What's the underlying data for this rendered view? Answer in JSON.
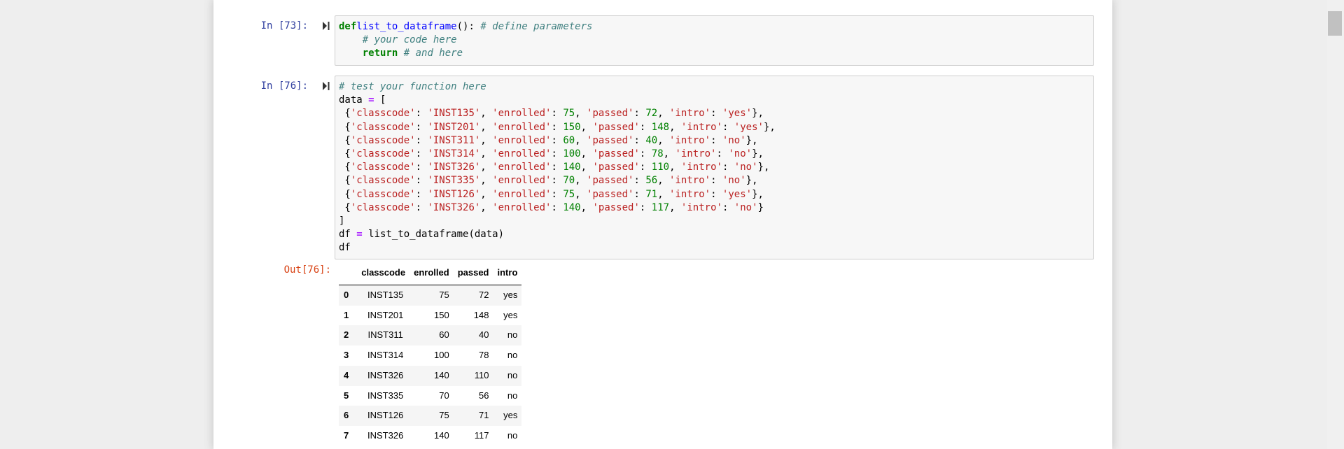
{
  "cells": [
    {
      "prompt": "In [73]:",
      "code_tokens": [
        [
          "kw",
          "def"
        ],
        [
          "",
          ""
        ],
        [
          "fn",
          "list_to_dataframe"
        ],
        [
          "",
          "(): "
        ],
        [
          "cm",
          "# define parameters"
        ],
        [
          "",
          "\n    "
        ],
        [
          "cm",
          "# your code here"
        ],
        [
          "",
          "\n    "
        ],
        [
          "kw",
          "return"
        ],
        [
          "",
          " "
        ],
        [
          "cm",
          "# and here"
        ]
      ]
    },
    {
      "prompt": "In [76]:",
      "code_tokens": [
        [
          "cm",
          "# test your function here"
        ],
        [
          "",
          "\ndata "
        ],
        [
          "op",
          "="
        ],
        [
          "",
          " [\n {"
        ],
        [
          "st",
          "'classcode'"
        ],
        [
          "",
          ": "
        ],
        [
          "st",
          "'INST135'"
        ],
        [
          "",
          ", "
        ],
        [
          "st",
          "'enrolled'"
        ],
        [
          "",
          ": "
        ],
        [
          "nm",
          "75"
        ],
        [
          "",
          ", "
        ],
        [
          "st",
          "'passed'"
        ],
        [
          "",
          ": "
        ],
        [
          "nm",
          "72"
        ],
        [
          "",
          ", "
        ],
        [
          "st",
          "'intro'"
        ],
        [
          "",
          ": "
        ],
        [
          "st",
          "'yes'"
        ],
        [
          "",
          "},\n {"
        ],
        [
          "st",
          "'classcode'"
        ],
        [
          "",
          ": "
        ],
        [
          "st",
          "'INST201'"
        ],
        [
          "",
          ", "
        ],
        [
          "st",
          "'enrolled'"
        ],
        [
          "",
          ": "
        ],
        [
          "nm",
          "150"
        ],
        [
          "",
          ", "
        ],
        [
          "st",
          "'passed'"
        ],
        [
          "",
          ": "
        ],
        [
          "nm",
          "148"
        ],
        [
          "",
          ", "
        ],
        [
          "st",
          "'intro'"
        ],
        [
          "",
          ": "
        ],
        [
          "st",
          "'yes'"
        ],
        [
          "",
          "},\n {"
        ],
        [
          "st",
          "'classcode'"
        ],
        [
          "",
          ": "
        ],
        [
          "st",
          "'INST311'"
        ],
        [
          "",
          ", "
        ],
        [
          "st",
          "'enrolled'"
        ],
        [
          "",
          ": "
        ],
        [
          "nm",
          "60"
        ],
        [
          "",
          ", "
        ],
        [
          "st",
          "'passed'"
        ],
        [
          "",
          ": "
        ],
        [
          "nm",
          "40"
        ],
        [
          "",
          ", "
        ],
        [
          "st",
          "'intro'"
        ],
        [
          "",
          ": "
        ],
        [
          "st",
          "'no'"
        ],
        [
          "",
          "},\n {"
        ],
        [
          "st",
          "'classcode'"
        ],
        [
          "",
          ": "
        ],
        [
          "st",
          "'INST314'"
        ],
        [
          "",
          ", "
        ],
        [
          "st",
          "'enrolled'"
        ],
        [
          "",
          ": "
        ],
        [
          "nm",
          "100"
        ],
        [
          "",
          ", "
        ],
        [
          "st",
          "'passed'"
        ],
        [
          "",
          ": "
        ],
        [
          "nm",
          "78"
        ],
        [
          "",
          ", "
        ],
        [
          "st",
          "'intro'"
        ],
        [
          "",
          ": "
        ],
        [
          "st",
          "'no'"
        ],
        [
          "",
          "},\n {"
        ],
        [
          "st",
          "'classcode'"
        ],
        [
          "",
          ": "
        ],
        [
          "st",
          "'INST326'"
        ],
        [
          "",
          ", "
        ],
        [
          "st",
          "'enrolled'"
        ],
        [
          "",
          ": "
        ],
        [
          "nm",
          "140"
        ],
        [
          "",
          ", "
        ],
        [
          "st",
          "'passed'"
        ],
        [
          "",
          ": "
        ],
        [
          "nm",
          "110"
        ],
        [
          "",
          ", "
        ],
        [
          "st",
          "'intro'"
        ],
        [
          "",
          ": "
        ],
        [
          "st",
          "'no'"
        ],
        [
          "",
          "},\n {"
        ],
        [
          "st",
          "'classcode'"
        ],
        [
          "",
          ": "
        ],
        [
          "st",
          "'INST335'"
        ],
        [
          "",
          ", "
        ],
        [
          "st",
          "'enrolled'"
        ],
        [
          "",
          ": "
        ],
        [
          "nm",
          "70"
        ],
        [
          "",
          ", "
        ],
        [
          "st",
          "'passed'"
        ],
        [
          "",
          ": "
        ],
        [
          "nm",
          "56"
        ],
        [
          "",
          ", "
        ],
        [
          "st",
          "'intro'"
        ],
        [
          "",
          ": "
        ],
        [
          "st",
          "'no'"
        ],
        [
          "",
          "},\n {"
        ],
        [
          "st",
          "'classcode'"
        ],
        [
          "",
          ": "
        ],
        [
          "st",
          "'INST126'"
        ],
        [
          "",
          ", "
        ],
        [
          "st",
          "'enrolled'"
        ],
        [
          "",
          ": "
        ],
        [
          "nm",
          "75"
        ],
        [
          "",
          ", "
        ],
        [
          "st",
          "'passed'"
        ],
        [
          "",
          ": "
        ],
        [
          "nm",
          "71"
        ],
        [
          "",
          ", "
        ],
        [
          "st",
          "'intro'"
        ],
        [
          "",
          ": "
        ],
        [
          "st",
          "'yes'"
        ],
        [
          "",
          "},\n {"
        ],
        [
          "st",
          "'classcode'"
        ],
        [
          "",
          ": "
        ],
        [
          "st",
          "'INST326'"
        ],
        [
          "",
          ", "
        ],
        [
          "st",
          "'enrolled'"
        ],
        [
          "",
          ": "
        ],
        [
          "nm",
          "140"
        ],
        [
          "",
          ", "
        ],
        [
          "st",
          "'passed'"
        ],
        [
          "",
          ": "
        ],
        [
          "nm",
          "117"
        ],
        [
          "",
          ", "
        ],
        [
          "st",
          "'intro'"
        ],
        [
          "",
          ": "
        ],
        [
          "st",
          "'no'"
        ],
        [
          "",
          "}\n]\ndf "
        ],
        [
          "op",
          "="
        ],
        [
          "",
          " list_to_dataframe(data)\ndf"
        ]
      ],
      "output": {
        "prompt": "Out[76]:",
        "columns": [
          "classcode",
          "enrolled",
          "passed",
          "intro"
        ],
        "rows": [
          {
            "index": "0",
            "values": [
              "INST135",
              "75",
              "72",
              "yes"
            ]
          },
          {
            "index": "1",
            "values": [
              "INST201",
              "150",
              "148",
              "yes"
            ]
          },
          {
            "index": "2",
            "values": [
              "INST311",
              "60",
              "40",
              "no"
            ]
          },
          {
            "index": "3",
            "values": [
              "INST314",
              "100",
              "78",
              "no"
            ]
          },
          {
            "index": "4",
            "values": [
              "INST326",
              "140",
              "110",
              "no"
            ]
          },
          {
            "index": "5",
            "values": [
              "INST335",
              "70",
              "56",
              "no"
            ]
          },
          {
            "index": "6",
            "values": [
              "INST126",
              "75",
              "71",
              "yes"
            ]
          },
          {
            "index": "7",
            "values": [
              "INST326",
              "140",
              "117",
              "no"
            ]
          }
        ]
      }
    }
  ],
  "icons": {
    "run_button": "run-cell-icon"
  },
  "colors": {
    "in_prompt": "#303f9f",
    "out_prompt": "#d84315",
    "keyword": "#008000",
    "string": "#ba2121",
    "comment": "#408080",
    "number": "#008000",
    "function": "#0000ff",
    "operator": "#aa22ff"
  }
}
